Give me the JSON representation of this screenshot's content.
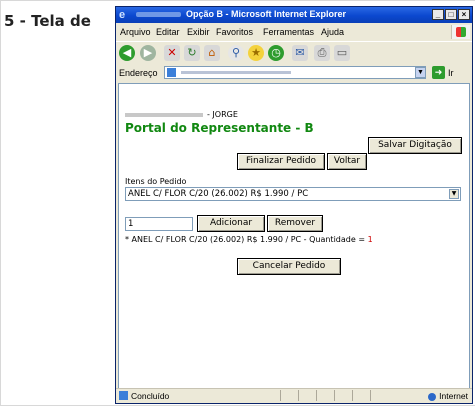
{
  "slide_heading": "5 - Tela de",
  "window": {
    "title": "Opção B - Microsoft Internet Explorer",
    "controls": [
      "_",
      "□",
      "×"
    ]
  },
  "menu": [
    "Arquivo",
    "Editar",
    "Exibir",
    "Favoritos",
    "Ferramentas",
    "Ajuda"
  ],
  "address": {
    "label": "Endereço",
    "go_label": "Ir"
  },
  "page": {
    "user_suffix": "- JORGE",
    "portal_title": "Portal do Representante - B",
    "save_button": "Salvar Digitação",
    "finish_button": "Finalizar Pedido",
    "back_button": "Voltar",
    "items_label": "Itens do Pedido",
    "selected_item": "ANEL C/ FLOR C/20 (26.002) R$ 1.990 / PC",
    "quantity_value": "1",
    "add_button": "Adicionar",
    "remove_button": "Remover",
    "summary_prefix": "* ANEL C/ FLOR C/20 (26.002) R$ 1.990 / PC - Quantidade = ",
    "summary_quantity": "1",
    "cancel_button": "Cancelar Pedido"
  },
  "status": {
    "text": "Concluído",
    "zone": "Internet"
  }
}
